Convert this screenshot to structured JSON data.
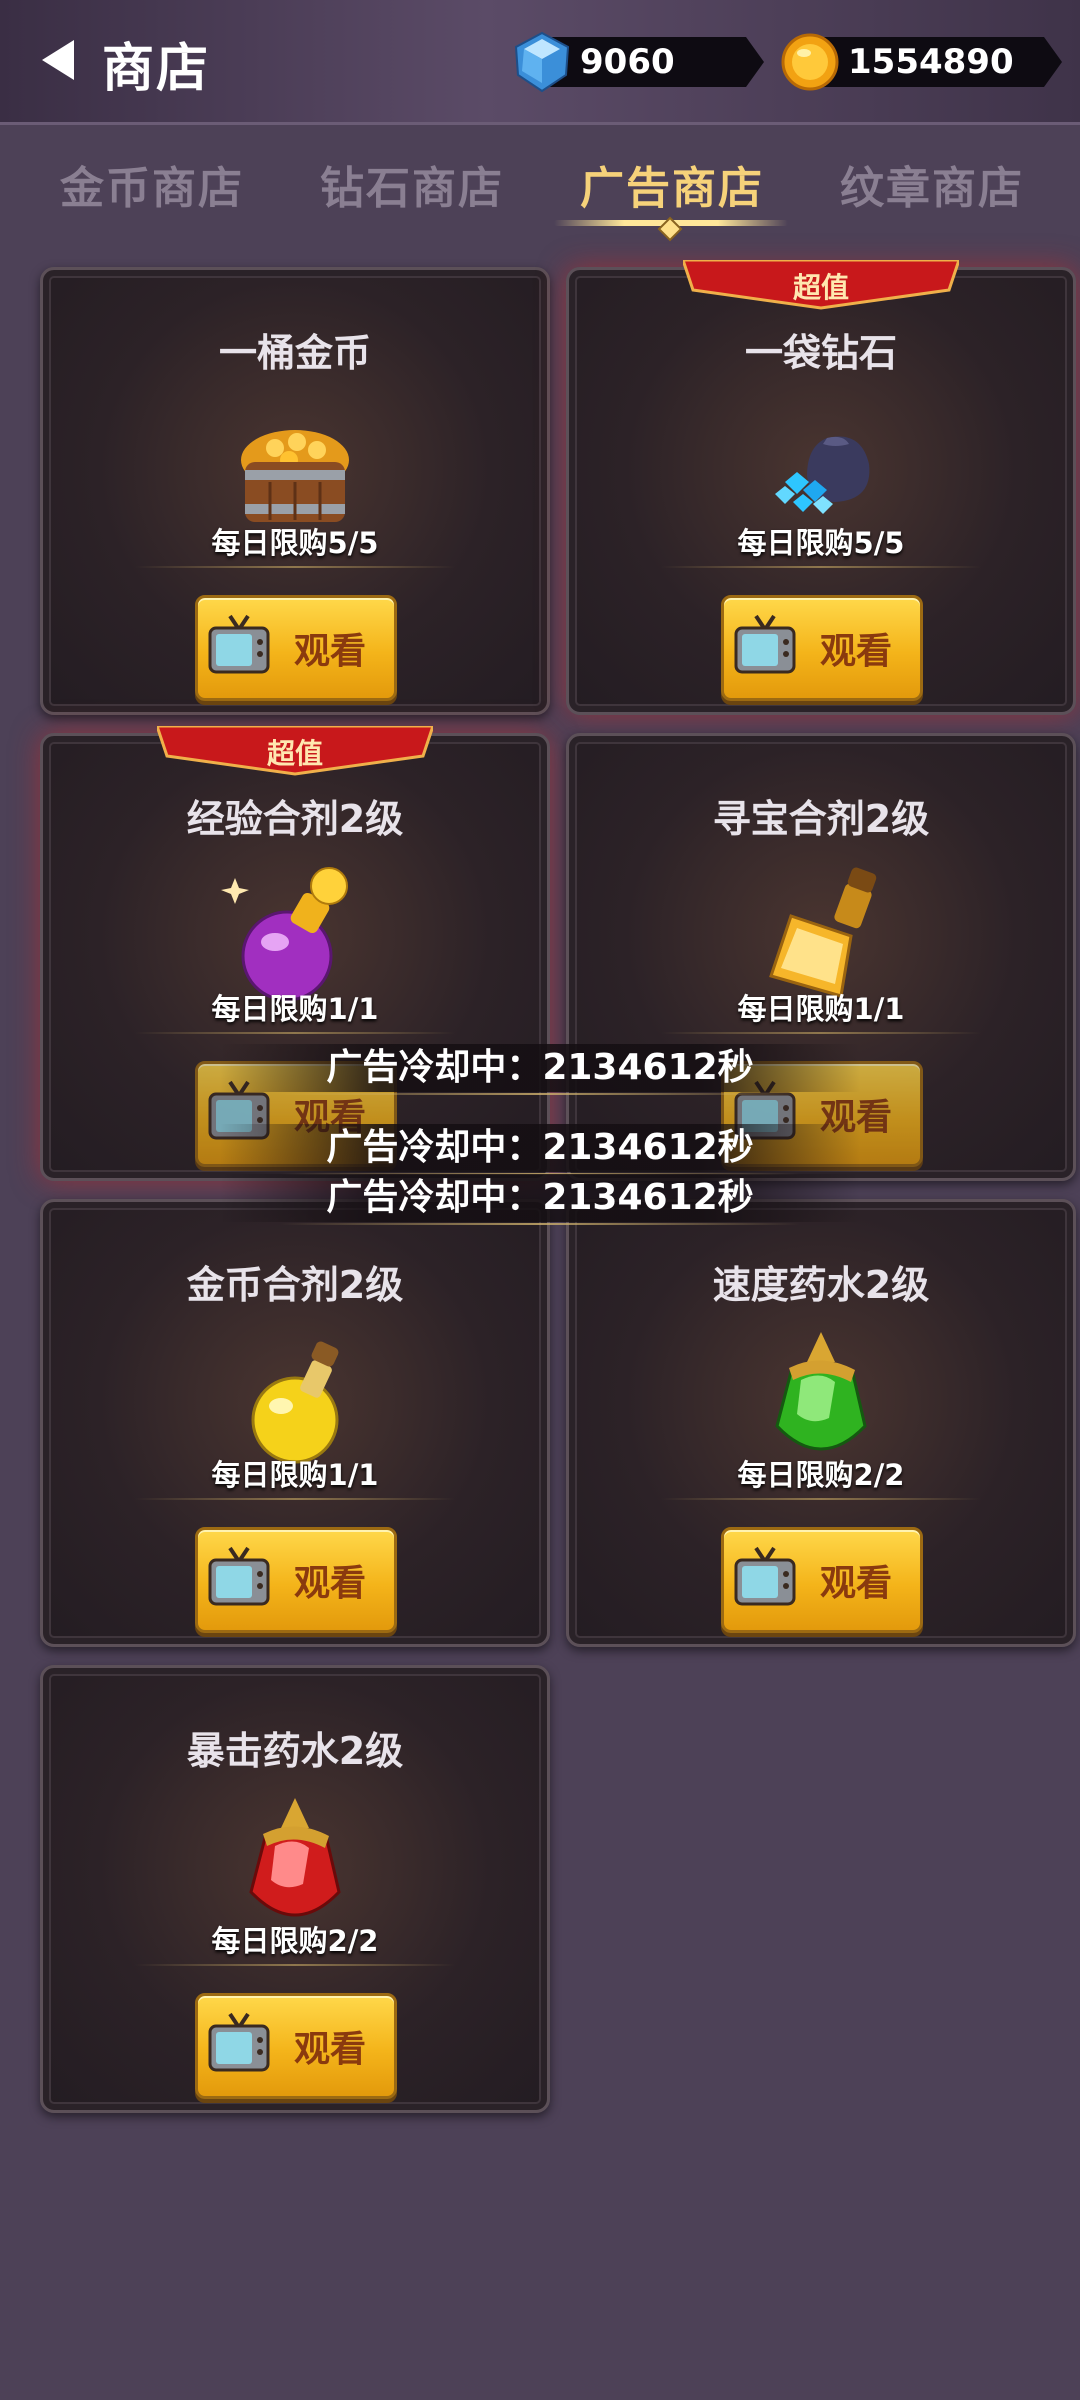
{
  "header": {
    "title": "商店",
    "back_icon": "back-arrow-icon",
    "gems": "9060",
    "coins": "1554890"
  },
  "tabs": [
    {
      "label": "金币商店",
      "active": false
    },
    {
      "label": "钻石商店",
      "active": false
    },
    {
      "label": "广告商店",
      "active": true
    },
    {
      "label": "纹章商店",
      "active": false
    }
  ],
  "items": [
    {
      "title": "一桶金币",
      "limit": "每日限购5/5",
      "button": "观看",
      "icon": "coin-barrel-icon",
      "badge": ""
    },
    {
      "title": "一袋钻石",
      "limit": "每日限购5/5",
      "button": "观看",
      "icon": "diamond-bag-icon",
      "badge": "超值"
    },
    {
      "title": "经验合剂2级",
      "limit": "每日限购1/1",
      "button": "观看",
      "icon": "purple-potion-icon",
      "badge": "超值"
    },
    {
      "title": "寻宝合剂2级",
      "limit": "每日限购1/1",
      "button": "观看",
      "icon": "gold-potion-icon",
      "badge": ""
    },
    {
      "title": "金币合剂2级",
      "limit": "每日限购1/1",
      "button": "观看",
      "icon": "yellow-potion-icon",
      "badge": ""
    },
    {
      "title": "速度药水2级",
      "limit": "每日限购2/2",
      "button": "观看",
      "icon": "green-potion-icon",
      "badge": ""
    },
    {
      "title": "暴击药水2级",
      "limit": "每日限购2/2",
      "button": "观看",
      "icon": "red-potion-icon",
      "badge": ""
    }
  ],
  "cooldown_messages": [
    "广告冷却中：2134612秒",
    "广告冷却中：2134612秒",
    "广告冷却中：2134612秒"
  ],
  "colors": {
    "background": "#4d4157",
    "active_tab": "#f6d27a",
    "button": "#f4b41a",
    "badge": "#c8181b"
  }
}
